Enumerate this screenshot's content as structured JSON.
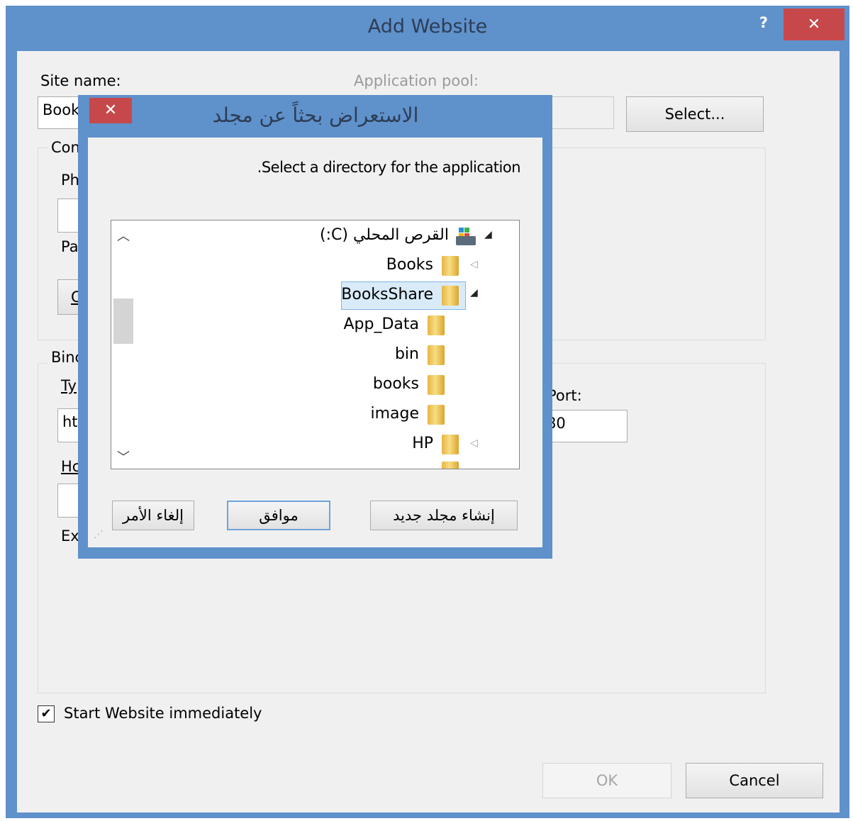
{
  "outer_dialog": {
    "title": "Add Website",
    "help_glyph": "?",
    "close_glyph": "✕",
    "site_name_label": "Site name:",
    "site_name_value": "Book",
    "application_pool_label": "Application pool:",
    "select_button": "Select...",
    "content_group_label": "Con",
    "physical_path_label": "Ph",
    "pass_through_label": "Pa",
    "connect_as_label": "C",
    "binding_group_label": "Binc",
    "type_label": "Ty",
    "type_value": "ht",
    "port_label": "Port:",
    "port_value": "80",
    "host_name_label": "Hc",
    "example_label": "Ex",
    "start_website_label": "Start Website immediately",
    "start_website_checked": true,
    "ok_button": "OK",
    "cancel_button": "Cancel"
  },
  "browse_dialog": {
    "title": "الاستعراض بحثاً عن مجلد",
    "close_glyph": "✕",
    "instruction": ".Select a directory for the application",
    "tree": [
      {
        "label": "القرص المحلي (C:)",
        "icon": "drive-icon",
        "expander": "expanded",
        "level": 0
      },
      {
        "label": "Books",
        "icon": "folder-icon",
        "expander": "collapsed",
        "level": 1
      },
      {
        "label": "BooksShare",
        "icon": "folder-icon",
        "expander": "expanded",
        "level": 1,
        "selected": true
      },
      {
        "label": "App_Data",
        "icon": "folder-icon",
        "expander": "none",
        "level": 2
      },
      {
        "label": "bin",
        "icon": "folder-icon",
        "expander": "none",
        "level": 2
      },
      {
        "label": "books",
        "icon": "folder-icon",
        "expander": "none",
        "level": 2
      },
      {
        "label": "image",
        "icon": "folder-icon",
        "expander": "none",
        "level": 2
      },
      {
        "label": "HP",
        "icon": "folder-icon",
        "expander": "collapsed",
        "level": 1
      }
    ],
    "new_folder_button": "إنشاء مجلد جديد",
    "ok_button": "موافق",
    "cancel_button": "إلغاء الأمر"
  },
  "colors": {
    "title_bar": "#5f91cb",
    "close_button": "#c7484a",
    "selection_fill": "#d9ebf9"
  }
}
